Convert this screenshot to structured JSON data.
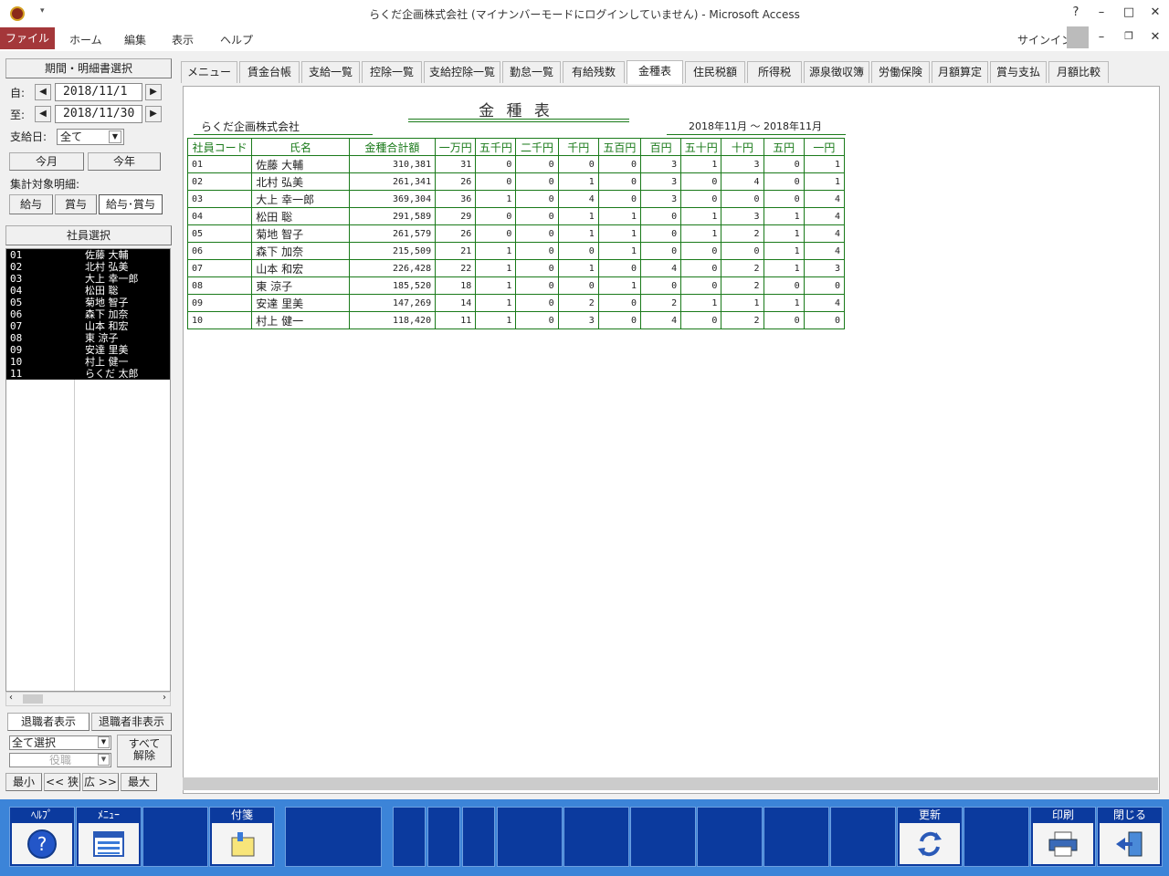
{
  "window": {
    "title": "らくだ企画株式会社 (マイナンバーモードにログインしていません) - Microsoft Access",
    "help_icon": "?",
    "min_icon": "–",
    "max_icon": "□",
    "close_icon": "✕"
  },
  "ribbon": {
    "tabs": [
      "ファイル",
      "ホーム",
      "編集",
      "表示",
      "ヘルプ"
    ],
    "signin": "サインイン"
  },
  "left": {
    "period_title": "期間・明細書選択",
    "from_label": "自:",
    "from_date": "2018/11/1",
    "to_label": "至:",
    "to_date": "2018/11/30",
    "payday_label": "支給日:",
    "payday_value": "全て",
    "this_month": "今月",
    "this_year": "今年",
    "target_label": "集計対象明細:",
    "target_buttons": [
      "給与",
      "賞与",
      "給与･賞与"
    ],
    "employee_select": "社員選択",
    "employees": [
      [
        "01",
        "佐藤 大輔"
      ],
      [
        "02",
        "北村 弘美"
      ],
      [
        "03",
        "大上 幸一郎"
      ],
      [
        "04",
        "松田 聡"
      ],
      [
        "05",
        "菊地 智子"
      ],
      [
        "06",
        "森下 加奈"
      ],
      [
        "07",
        "山本 和宏"
      ],
      [
        "08",
        "東 涼子"
      ],
      [
        "09",
        "安達 里美"
      ],
      [
        "10",
        "村上 健一"
      ],
      [
        "11",
        "らくだ 太郎"
      ]
    ],
    "retired_show": "退職者表示",
    "retired_hide": "退職者非表示",
    "select_all": "全て選択",
    "position": "役職",
    "clear_all": "すべて\n解除",
    "zoom": [
      "最小",
      "<< 狭",
      "広 >>",
      "最大"
    ]
  },
  "tabs": [
    "メニュー",
    "賃金台帳",
    "支給一覧",
    "控除一覧",
    "支給控除一覧",
    "勤怠一覧",
    "有給残数",
    "金種表",
    "住民税額",
    "所得税",
    "源泉徴収簿",
    "労働保険",
    "月額算定",
    "賞与支払",
    "月額比較"
  ],
  "report": {
    "title": "金 種 表",
    "company": "らくだ企画株式会社",
    "period": "2018年11月 ～ 2018年11月",
    "headers": [
      "社員コード",
      "氏名",
      "金種合計額",
      "一万円",
      "五千円",
      "二千円",
      "千円",
      "五百円",
      "百円",
      "五十円",
      "十円",
      "五円",
      "一円"
    ],
    "rows": [
      [
        "01",
        "佐藤 大輔",
        "310,381",
        "31",
        "0",
        "0",
        "0",
        "0",
        "3",
        "1",
        "3",
        "0",
        "1"
      ],
      [
        "02",
        "北村 弘美",
        "261,341",
        "26",
        "0",
        "0",
        "1",
        "0",
        "3",
        "0",
        "4",
        "0",
        "1"
      ],
      [
        "03",
        "大上 幸一郎",
        "369,304",
        "36",
        "1",
        "0",
        "4",
        "0",
        "3",
        "0",
        "0",
        "0",
        "4"
      ],
      [
        "04",
        "松田 聡",
        "291,589",
        "29",
        "0",
        "0",
        "1",
        "1",
        "0",
        "1",
        "3",
        "1",
        "4"
      ],
      [
        "05",
        "菊地 智子",
        "261,579",
        "26",
        "0",
        "0",
        "1",
        "1",
        "0",
        "1",
        "2",
        "1",
        "4"
      ],
      [
        "06",
        "森下 加奈",
        "215,509",
        "21",
        "1",
        "0",
        "0",
        "1",
        "0",
        "0",
        "0",
        "1",
        "4"
      ],
      [
        "07",
        "山本 和宏",
        "226,428",
        "22",
        "1",
        "0",
        "1",
        "0",
        "4",
        "0",
        "2",
        "1",
        "3"
      ],
      [
        "08",
        "東 涼子",
        "185,520",
        "18",
        "1",
        "0",
        "0",
        "1",
        "0",
        "0",
        "2",
        "0",
        "0"
      ],
      [
        "09",
        "安達 里美",
        "147,269",
        "14",
        "1",
        "0",
        "2",
        "0",
        "2",
        "1",
        "1",
        "1",
        "4"
      ],
      [
        "10",
        "村上 健一",
        "118,420",
        "11",
        "1",
        "0",
        "3",
        "0",
        "4",
        "0",
        "2",
        "0",
        "0"
      ]
    ]
  },
  "footer": {
    "help": "ﾍﾙﾌﾟ",
    "menu": "ﾒﾆｭｰ",
    "sticky": "付箋",
    "refresh": "更新",
    "print": "印刷",
    "close": "閉じる"
  }
}
